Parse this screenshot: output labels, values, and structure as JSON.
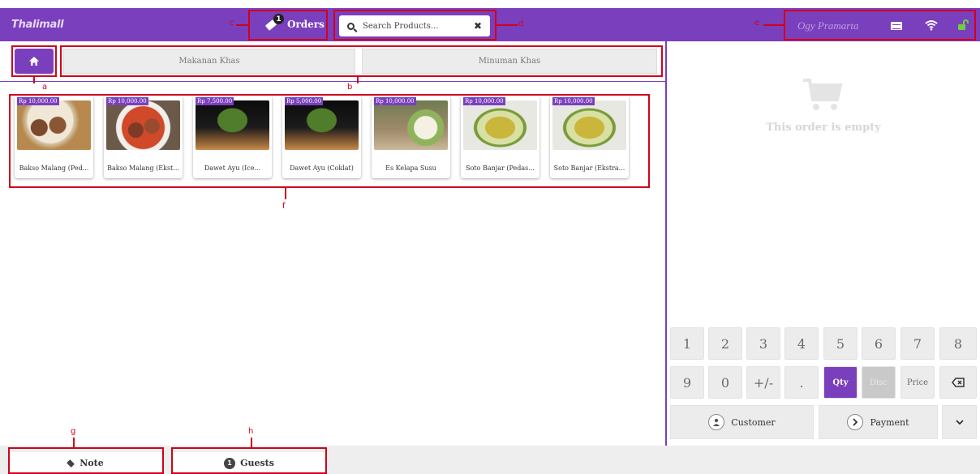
{
  "header": {
    "logo": "Thalimall",
    "orders_label": "Orders",
    "orders_count": "1",
    "search_placeholder": "Search Products...",
    "user_name": "Ogy Pramarta"
  },
  "categories": {
    "items": [
      "Makanan Khas",
      "Minuman Khas"
    ]
  },
  "products": [
    {
      "price": "Rp 10,000.00",
      "name": "Bakso Malang (Ped..."
    },
    {
      "price": "Rp 10,000.00",
      "name": "Bakso Malang (Ekst..."
    },
    {
      "price": "Rp 7,500.00",
      "name": "Dawet Ayu (Ice..."
    },
    {
      "price": "Rp 5,000.00",
      "name": "Dawet Ayu (Coklat)"
    },
    {
      "price": "Rp 10,000.00",
      "name": "Es Kelapa Susu"
    },
    {
      "price": "Rp 10,000.00",
      "name": "Soto Banjar (Pedas..."
    },
    {
      "price": "Rp 10,000.00",
      "name": "Soto Banjar (Ekstra..."
    }
  ],
  "order": {
    "empty_text": "This order is empty"
  },
  "keypad": {
    "row1": [
      "1",
      "2",
      "3",
      "4",
      "5",
      "6",
      "7",
      "8"
    ],
    "row2": [
      "9",
      "0",
      "+/-",
      ".",
      "Qty",
      "Disc",
      "Price"
    ],
    "customer_label": "Customer",
    "payment_label": "Payment"
  },
  "footer": {
    "note_label": "Note",
    "guests_label": "Guests",
    "guests_count": "1"
  },
  "annotations": {
    "a": "a",
    "b": "b",
    "c": "c",
    "d": "d",
    "e": "e",
    "f": "f",
    "g": "g",
    "h": "h"
  },
  "colors": {
    "accent": "#7a3fbd",
    "annotation": "#d0021b"
  }
}
